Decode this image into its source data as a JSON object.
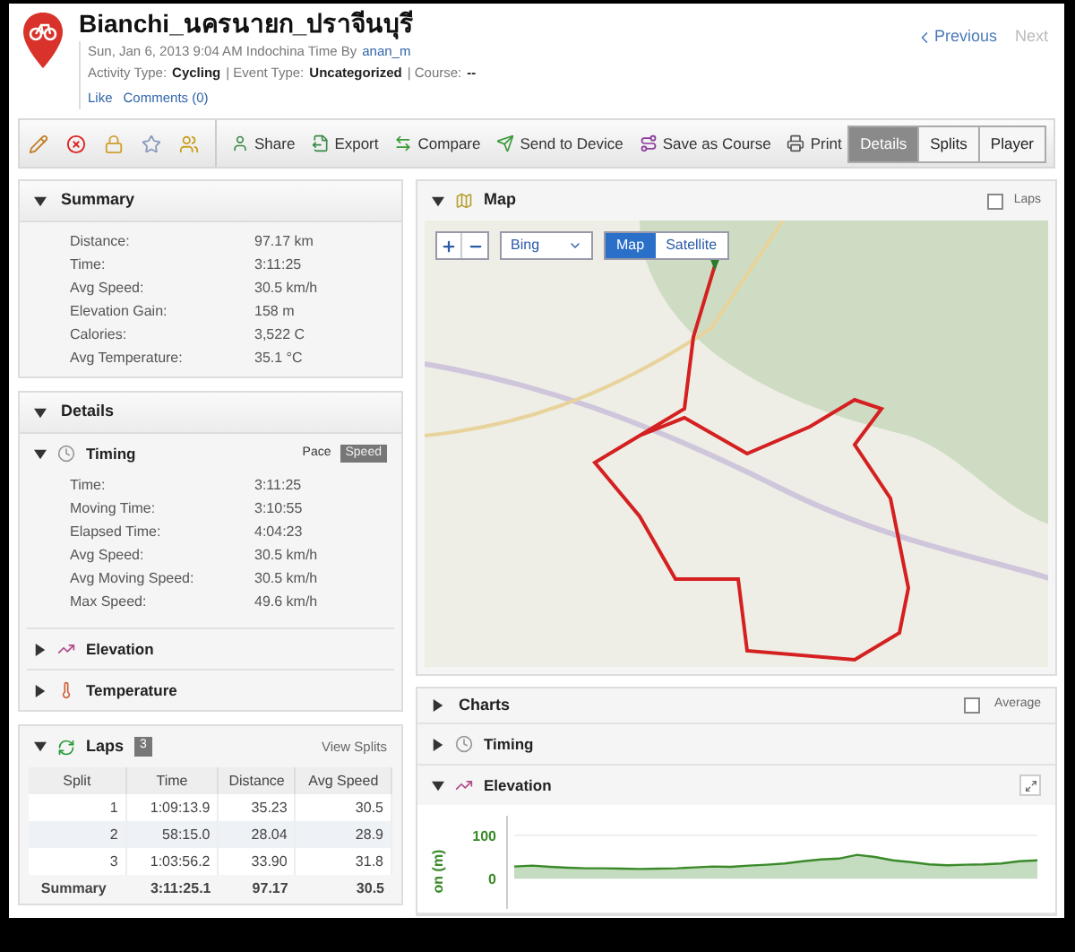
{
  "header": {
    "title": "Bianchi_นครนายก_ปราจีนบุรี",
    "date": "Sun, Jan 6, 2013 9:04 AM Indochina Time By",
    "author": "anan_m",
    "activity_label": "Activity Type:",
    "activity": "Cycling",
    "event_label": "| Event Type:",
    "event": "Uncategorized",
    "course_label": "| Course:",
    "course": "--",
    "like": "Like",
    "comments": "Comments (0)"
  },
  "nav": [
    {
      "label": "Previous",
      "disabled": false
    },
    {
      "label": "Next",
      "disabled": true
    }
  ],
  "toolbar": {
    "icons": [
      {
        "kind": "edit"
      },
      {
        "kind": "delete"
      },
      {
        "kind": "lock"
      },
      {
        "kind": "favorite"
      },
      {
        "kind": "people"
      }
    ],
    "actions": [
      {
        "label": "Share",
        "kind": "share"
      },
      {
        "label": "Export",
        "kind": "export"
      },
      {
        "label": "Compare",
        "kind": "compare"
      },
      {
        "label": "Send to Device",
        "kind": "send"
      },
      {
        "label": "Save as Course",
        "kind": "course"
      },
      {
        "label": "Print",
        "kind": "print"
      }
    ],
    "views": [
      {
        "label": "Details",
        "selected": true
      },
      {
        "label": "Splits",
        "selected": false
      },
      {
        "label": "Player",
        "selected": false
      }
    ]
  },
  "summary": {
    "title": "Summary",
    "expanded": true,
    "rows": [
      {
        "label": "Distance:",
        "value": "97.17 km"
      },
      {
        "label": "Time:",
        "value": "3:11:25"
      },
      {
        "label": "Avg Speed:",
        "value": "30.5 km/h"
      },
      {
        "label": "Elevation Gain:",
        "value": "158 m"
      },
      {
        "label": "Calories:",
        "value": "3,522 C"
      },
      {
        "label": "Avg Temperature:",
        "value": "35.1 °C"
      }
    ]
  },
  "details": {
    "title": "Details",
    "expanded": true,
    "sections": [
      {
        "title": "Timing",
        "kind": "timing",
        "expanded": true,
        "toggle": [
          {
            "label": "Pace",
            "selected": false
          },
          {
            "label": "Speed",
            "selected": true
          }
        ],
        "rows": [
          {
            "label": "Time:",
            "value": "3:11:25"
          },
          {
            "label": "Moving Time:",
            "value": "3:10:55"
          },
          {
            "label": "Elapsed Time:",
            "value": "4:04:23"
          },
          {
            "label": "Avg Speed:",
            "value": "30.5 km/h"
          },
          {
            "label": "Avg Moving Speed:",
            "value": "30.5 km/h"
          },
          {
            "label": "Max Speed:",
            "value": "49.6 km/h"
          }
        ]
      },
      {
        "title": "Elevation",
        "kind": "elevation",
        "expanded": false
      },
      {
        "title": "Temperature",
        "kind": "temperature",
        "expanded": false
      }
    ]
  },
  "laps": {
    "title": "Laps",
    "count": "3",
    "expanded": true,
    "link": "View Splits",
    "columns": [
      "Split",
      "Time",
      "Distance",
      "Avg Speed"
    ],
    "rows": [
      [
        "1",
        "1:09:13.9",
        "35.23",
        "30.5"
      ],
      [
        "2",
        "58:15.0",
        "28.04",
        "28.9"
      ],
      [
        "3",
        "1:03:56.2",
        "33.90",
        "31.8"
      ]
    ],
    "total": [
      "Summary",
      "3:11:25.1",
      "97.17",
      "30.5"
    ]
  },
  "map": {
    "title": "Map",
    "expanded": true,
    "laps_label": "Laps",
    "laps_checked": false,
    "provider": "Bing",
    "types": [
      {
        "label": "Map",
        "selected": true
      },
      {
        "label": "Satellite",
        "selected": false
      }
    ]
  },
  "charts": {
    "title": "Charts",
    "expanded": false,
    "average_label": "Average",
    "average_checked": false,
    "sections": [
      {
        "title": "Timing",
        "kind": "timing",
        "expanded": false
      },
      {
        "title": "Elevation",
        "kind": "elevation",
        "expanded": true,
        "chart_data": {
          "type": "area",
          "ylabel": "on (m)",
          "yticks": [
            0,
            100
          ],
          "ylim": [
            -70,
            145
          ],
          "series": [
            {
              "color": "#3a8a2a",
              "values": [
                28,
                30,
                27,
                25,
                24,
                24,
                23,
                22,
                23,
                24,
                26,
                28,
                27,
                30,
                32,
                35,
                40,
                44,
                46,
                55,
                50,
                42,
                38,
                33,
                31,
                32,
                33,
                35,
                40,
                42
              ]
            }
          ]
        }
      }
    ]
  }
}
